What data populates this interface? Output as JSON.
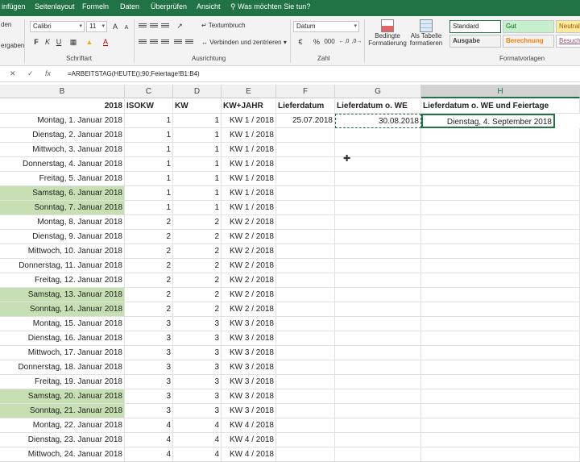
{
  "ribbon_tabs": [
    "infügen",
    "Seitenlayout",
    "Formeln",
    "Daten",
    "Überprüfen",
    "Ansicht"
  ],
  "tell_me": "Was möchten Sie tun?",
  "clipboard": {
    "paste_fragment": "den",
    "format_fragment": "ergaben"
  },
  "font": {
    "name": "Calibri",
    "size": "11",
    "group_label": "Schriftart"
  },
  "alignment": {
    "wrap_text": "Textumbruch",
    "merge_center": "Verbinden und zentrieren",
    "group_label": "Ausrichtung"
  },
  "number": {
    "format": "Datum",
    "group_label": "Zahl"
  },
  "styles": {
    "conditional": [
      "Bedingte",
      "Formatierung"
    ],
    "as_table": [
      "Als Tabelle",
      "formatieren"
    ],
    "cells": [
      "Standard",
      "Gut",
      "Neutral",
      "Ausgabe",
      "Berechnung",
      "Besuch"
    ],
    "group_label": "Formatvorlagen",
    "colors": {
      "gut_bg": "#c6efce",
      "gut_fg": "#006100",
      "neutral_bg": "#ffeb9c",
      "neutral_fg": "#9c5700",
      "berechnung_fg": "#fa7d00",
      "besuch_fg": "#954f72"
    }
  },
  "formula_bar": {
    "formula": "=ARBEITSTAG(HEUTE();90;Feiertage!B1:B4)"
  },
  "columns": [
    "B",
    "C",
    "D",
    "E",
    "F",
    "G",
    "H"
  ],
  "header_row": {
    "year": "2018",
    "isokw": "ISOKW",
    "kw": "KW",
    "kw_jahr": "KW+JAHR",
    "lieferdatum": "Lieferdatum",
    "liefer_we": "Lieferdatum o. WE",
    "liefer_we_feiertage": "Lieferdatum o. WE und Feiertage"
  },
  "first_row": {
    "lieferdatum": "25.07.2018",
    "liefer_we": "30.08.2018",
    "liefer_we_feiertage": "Dienstag, 4. September 2018"
  },
  "rows": [
    {
      "date": "Montag, 1. Januar 2018",
      "isokw": "1",
      "kw": "1",
      "kwj": "KW 1 / 2018",
      "weekend": false
    },
    {
      "date": "Dienstag, 2. Januar 2018",
      "isokw": "1",
      "kw": "1",
      "kwj": "KW 1 / 2018",
      "weekend": false
    },
    {
      "date": "Mittwoch, 3. Januar 2018",
      "isokw": "1",
      "kw": "1",
      "kwj": "KW 1 / 2018",
      "weekend": false
    },
    {
      "date": "Donnerstag, 4. Januar 2018",
      "isokw": "1",
      "kw": "1",
      "kwj": "KW 1 / 2018",
      "weekend": false
    },
    {
      "date": "Freitag, 5. Januar 2018",
      "isokw": "1",
      "kw": "1",
      "kwj": "KW 1 / 2018",
      "weekend": false
    },
    {
      "date": "Samstag, 6. Januar 2018",
      "isokw": "1",
      "kw": "1",
      "kwj": "KW 1 / 2018",
      "weekend": true
    },
    {
      "date": "Sonntag, 7. Januar 2018",
      "isokw": "1",
      "kw": "1",
      "kwj": "KW 1 / 2018",
      "weekend": true
    },
    {
      "date": "Montag, 8. Januar 2018",
      "isokw": "2",
      "kw": "2",
      "kwj": "KW 2 / 2018",
      "weekend": false
    },
    {
      "date": "Dienstag, 9. Januar 2018",
      "isokw": "2",
      "kw": "2",
      "kwj": "KW 2 / 2018",
      "weekend": false
    },
    {
      "date": "Mittwoch, 10. Januar 2018",
      "isokw": "2",
      "kw": "2",
      "kwj": "KW 2 / 2018",
      "weekend": false
    },
    {
      "date": "Donnerstag, 11. Januar 2018",
      "isokw": "2",
      "kw": "2",
      "kwj": "KW 2 / 2018",
      "weekend": false
    },
    {
      "date": "Freitag, 12. Januar 2018",
      "isokw": "2",
      "kw": "2",
      "kwj": "KW 2 / 2018",
      "weekend": false
    },
    {
      "date": "Samstag, 13. Januar 2018",
      "isokw": "2",
      "kw": "2",
      "kwj": "KW 2 / 2018",
      "weekend": true
    },
    {
      "date": "Sonntag, 14. Januar 2018",
      "isokw": "2",
      "kw": "2",
      "kwj": "KW 2 / 2018",
      "weekend": true
    },
    {
      "date": "Montag, 15. Januar 2018",
      "isokw": "3",
      "kw": "3",
      "kwj": "KW 3 / 2018",
      "weekend": false
    },
    {
      "date": "Dienstag, 16. Januar 2018",
      "isokw": "3",
      "kw": "3",
      "kwj": "KW 3 / 2018",
      "weekend": false
    },
    {
      "date": "Mittwoch, 17. Januar 2018",
      "isokw": "3",
      "kw": "3",
      "kwj": "KW 3 / 2018",
      "weekend": false
    },
    {
      "date": "Donnerstag, 18. Januar 2018",
      "isokw": "3",
      "kw": "3",
      "kwj": "KW 3 / 2018",
      "weekend": false
    },
    {
      "date": "Freitag, 19. Januar 2018",
      "isokw": "3",
      "kw": "3",
      "kwj": "KW 3 / 2018",
      "weekend": false
    },
    {
      "date": "Samstag, 20. Januar 2018",
      "isokw": "3",
      "kw": "3",
      "kwj": "KW 3 / 2018",
      "weekend": true
    },
    {
      "date": "Sonntag, 21. Januar 2018",
      "isokw": "3",
      "kw": "3",
      "kwj": "KW 3 / 2018",
      "weekend": true
    },
    {
      "date": "Montag, 22. Januar 2018",
      "isokw": "4",
      "kw": "4",
      "kwj": "KW 4 / 2018",
      "weekend": false
    },
    {
      "date": "Dienstag, 23. Januar 2018",
      "isokw": "4",
      "kw": "4",
      "kwj": "KW 4 / 2018",
      "weekend": false
    },
    {
      "date": "Mittwoch, 24. Januar 2018",
      "isokw": "4",
      "kw": "4",
      "kwj": "KW 4 / 2018",
      "weekend": false
    }
  ]
}
